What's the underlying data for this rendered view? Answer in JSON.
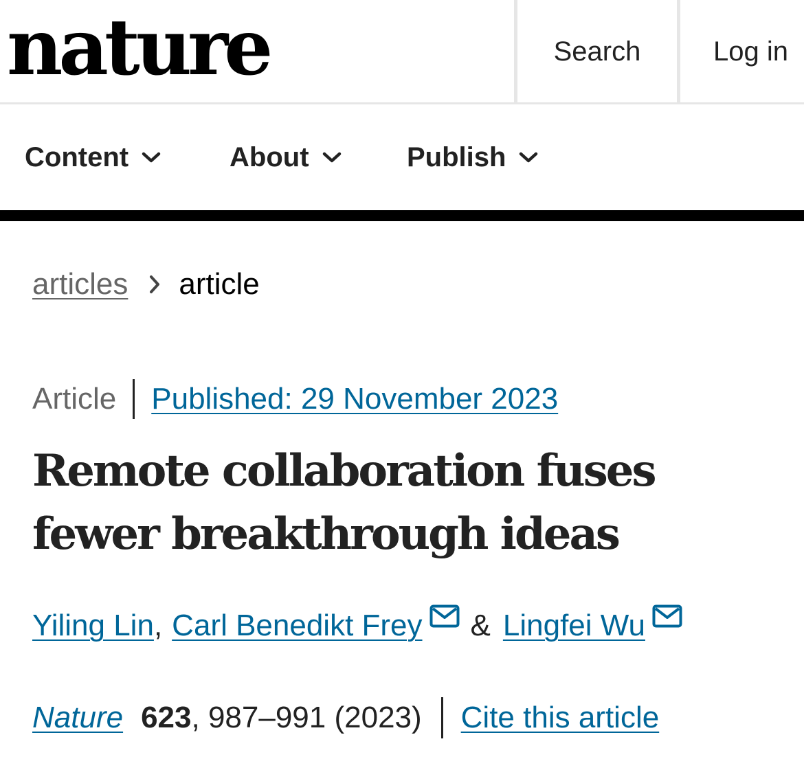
{
  "header": {
    "logo": "nature",
    "search_label": "Search",
    "login_label": "Log in"
  },
  "nav": {
    "items": [
      {
        "label": "Content"
      },
      {
        "label": "About"
      },
      {
        "label": "Publish"
      }
    ]
  },
  "breadcrumb": {
    "parent": "articles",
    "current": "article"
  },
  "article": {
    "type": "Article",
    "published": "Published: 29 November 2023",
    "title": "Remote collaboration fuses fewer breakthrough ideas",
    "authors": [
      {
        "name": "Yiling Lin"
      },
      {
        "name": "Carl Benedikt Frey"
      },
      {
        "name": "Lingfei Wu"
      }
    ],
    "separators": {
      "comma": ",",
      "and": "&"
    },
    "citation": {
      "journal": "Nature",
      "volume": "623",
      "pages": ", 987–991 (2023)",
      "cite_label": "Cite this article"
    }
  },
  "colors": {
    "link": "#006699",
    "text": "#222222",
    "muted": "#666666",
    "rule": "#000000",
    "divider": "#e6e6e6"
  },
  "icons": {
    "nav_chevron": "chevron-down-icon",
    "breadcrumb_separator": "chevron-right-icon",
    "author_contact": "mail-icon"
  }
}
